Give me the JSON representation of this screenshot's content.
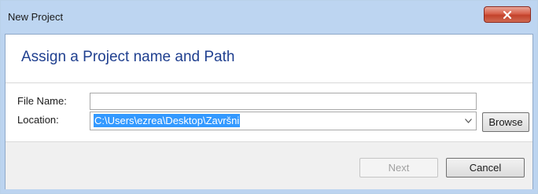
{
  "window": {
    "title": "New Project",
    "close_icon": "close-icon"
  },
  "header": {
    "heading": "Assign a Project name and Path"
  },
  "form": {
    "file_name_label": "File Name:",
    "file_name_value": "",
    "location_label": "Location:",
    "location_value": "C:\\Users\\ezrea\\Desktop\\Završni",
    "dropdown_icon": "chevron-down-icon",
    "browse_label": "Browse"
  },
  "footer": {
    "next_label": "Next",
    "cancel_label": "Cancel"
  },
  "colors": {
    "title_bar": "#bdd5f1",
    "heading": "#1f3f8f",
    "selection": "#3399ff",
    "close_button": "#c3422b"
  }
}
